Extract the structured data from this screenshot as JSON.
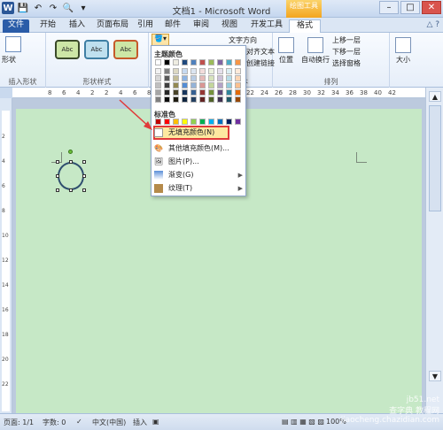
{
  "titlebar": {
    "title": "文档1 - Microsoft Word",
    "context_tab": "绘图工具",
    "min": "–",
    "max": "□",
    "close": "✕"
  },
  "tabs": {
    "file": "文件",
    "items": [
      "开始",
      "插入",
      "页面布局",
      "引用",
      "邮件",
      "审阅",
      "视图",
      "开发工具",
      "格式"
    ]
  },
  "ribbon": {
    "insert_shape_label": "形状",
    "insert_shape_group": "插入形状",
    "shape_style_group": "形状样式",
    "abc": "Abc",
    "text_direction": "文字方向",
    "align_text": "对齐文本",
    "create_link": "创建链接",
    "text_group": "文本",
    "position": "位置",
    "wrap_text": "自动换行",
    "bring_forward": "上移一层",
    "send_backward": "下移一层",
    "selection_pane": "选择窗格",
    "arrange_group": "排列",
    "size": "大小"
  },
  "ruler": {
    "h_ticks": [
      "8",
      "6",
      "4",
      "2",
      "2",
      "4",
      "6",
      "8",
      "10",
      "12",
      "14",
      "16",
      "18",
      "20",
      "22",
      "24",
      "26",
      "28",
      "30",
      "32",
      "34",
      "36",
      "38",
      "40",
      "42"
    ],
    "v_ticks": [
      "2",
      "4",
      "6",
      "8",
      "10",
      "12",
      "14",
      "16",
      "18",
      "20",
      "22"
    ]
  },
  "dropdown": {
    "theme_colors": "主题颜色",
    "standard_colors": "标准色",
    "no_fill": "无填充颜色(N)",
    "more_colors": "其他填充颜色(M)...",
    "picture": "图片(P)...",
    "gradient": "渐变(G)",
    "texture": "纹理(T)",
    "theme_top_row": [
      "#ffffff",
      "#000000",
      "#eeece1",
      "#1f497d",
      "#4f81bd",
      "#c0504d",
      "#9bbb59",
      "#8064a2",
      "#4bacc6",
      "#f79646"
    ],
    "theme_shades": [
      [
        "#f2f2f2",
        "#7f7f7f",
        "#ddd9c3",
        "#c6d9f0",
        "#dbe5f1",
        "#f2dcdb",
        "#ebf1dd",
        "#e5e0ec",
        "#dbeef3",
        "#fdeada"
      ],
      [
        "#d8d8d8",
        "#595959",
        "#c4bd97",
        "#8db3e2",
        "#b8cce4",
        "#e5b9b7",
        "#d7e3bc",
        "#ccc1d9",
        "#b7dde8",
        "#fbd5b5"
      ],
      [
        "#bfbfbf",
        "#3f3f3f",
        "#938953",
        "#548dd4",
        "#95b3d7",
        "#d99694",
        "#c3d69b",
        "#b2a2c7",
        "#92cddc",
        "#fac08f"
      ],
      [
        "#a5a5a5",
        "#262626",
        "#494429",
        "#17365d",
        "#366092",
        "#953734",
        "#76923c",
        "#5f497a",
        "#31859b",
        "#e36c09"
      ],
      [
        "#7f7f7f",
        "#0c0c0c",
        "#1d1b10",
        "#0f243e",
        "#244061",
        "#632423",
        "#4f6128",
        "#3f3151",
        "#205867",
        "#974806"
      ]
    ],
    "standard_row": [
      "#c00000",
      "#ff0000",
      "#ffc000",
      "#ffff00",
      "#92d050",
      "#00b050",
      "#00b0f0",
      "#0070c0",
      "#002060",
      "#7030a0"
    ]
  },
  "status": {
    "page": "页面: 1/1",
    "words": "字数: 0",
    "lang": "中文(中国)",
    "insert": "插入",
    "zoom": "100%"
  },
  "watermark": {
    "line1": "jb51.net",
    "line2": "查字典 教程网",
    "line3": "jiaocheng.chazidian.com"
  }
}
